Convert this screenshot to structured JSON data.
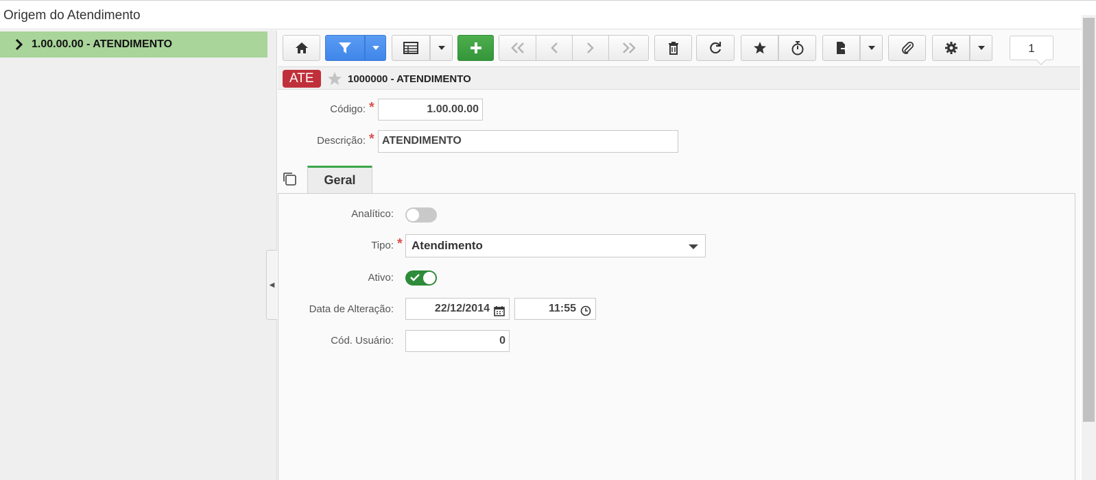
{
  "window": {
    "title": "Origem do Atendimento"
  },
  "sidebar": {
    "items": [
      {
        "label": "1.00.00.00 - ATENDIMENTO"
      }
    ]
  },
  "toolbar": {
    "page_number": "1"
  },
  "record": {
    "badge": "ATE",
    "title": "1000000 - ATENDIMENTO"
  },
  "form": {
    "codigo": {
      "label": "Código:",
      "value": "1.00.00.00"
    },
    "descricao": {
      "label": "Descrição:",
      "value": "ATENDIMENTO"
    }
  },
  "tabs": [
    {
      "label": "Geral"
    }
  ],
  "geral": {
    "analitico": {
      "label": "Analítico:",
      "checked": false
    },
    "tipo": {
      "label": "Tipo:",
      "value": "Atendimento"
    },
    "ativo": {
      "label": "Ativo:",
      "checked": true
    },
    "data_alteracao": {
      "label": "Data de Alteração:",
      "date": "22/12/2014",
      "time": "11:55"
    },
    "cod_usuario": {
      "label": "Cód. Usuário:",
      "value": "0"
    }
  },
  "colors": {
    "accent_blue": "#4a90ee",
    "accent_green": "#3aa54a",
    "badge_red": "#c0303a",
    "tree_selected": "#a9d49a"
  }
}
